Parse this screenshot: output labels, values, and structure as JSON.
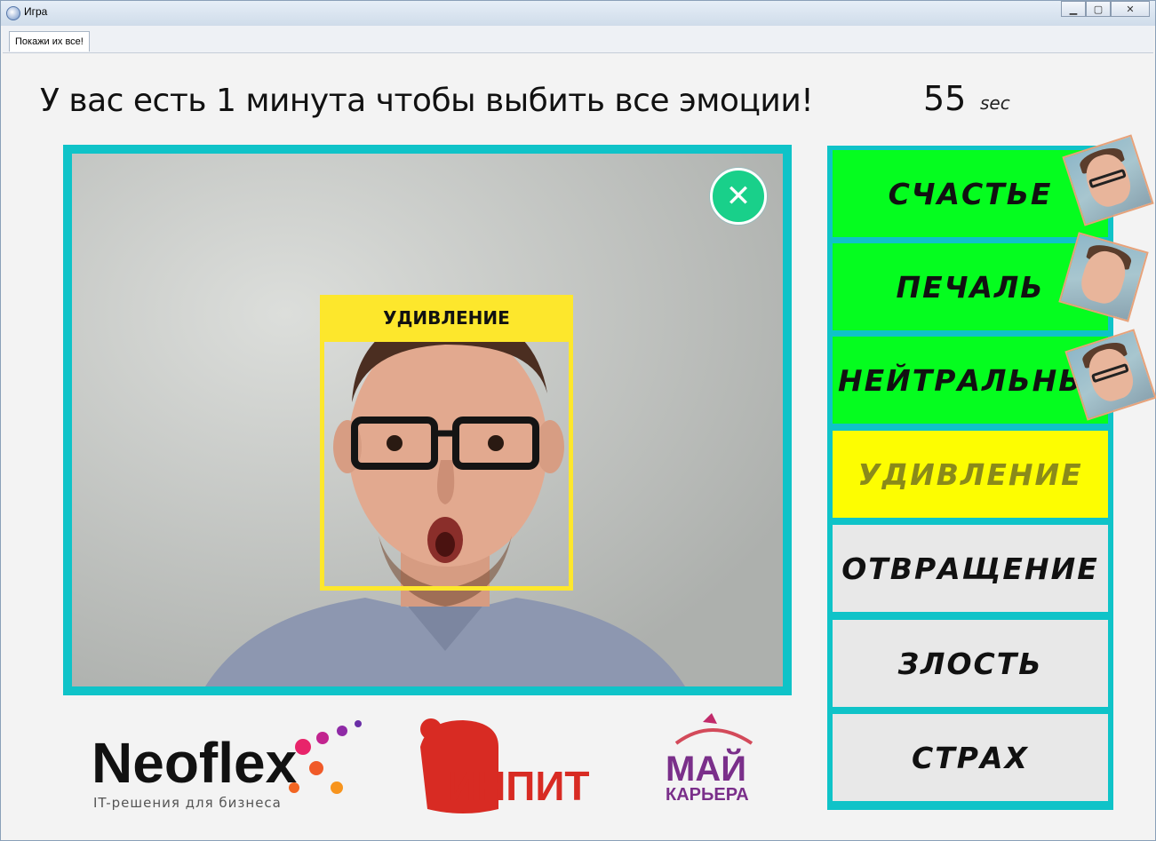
{
  "window": {
    "title": "Игра",
    "controls": {
      "minimize": "▁",
      "maximize": "▢",
      "close": "✕"
    }
  },
  "tabs": [
    {
      "label": "Покажи их все!"
    }
  ],
  "header": {
    "headline": "У вас есть 1 минута чтобы выбить все эмоции!",
    "timer_value": "55",
    "timer_unit": "sec"
  },
  "camera": {
    "detected_emotion": "УДИВЛЕНИЕ",
    "close_icon": "close-icon"
  },
  "emotions": [
    {
      "label": "СЧАСТЬЕ",
      "state": "done",
      "color": "#05fd1f"
    },
    {
      "label": "ПЕЧАЛЬ",
      "state": "done",
      "color": "#05fd1f"
    },
    {
      "label": "НЕЙТРАЛЬНЫ",
      "state": "done",
      "color": "#05fd1f"
    },
    {
      "label": "УДИВЛЕНИЕ",
      "state": "current",
      "color": "#fdfd01"
    },
    {
      "label": "ОТВРАЩЕНИЕ",
      "state": "pending",
      "color": "#e8e8e8"
    },
    {
      "label": "ЗЛОСТЬ",
      "state": "pending",
      "color": "#e8e8e8"
    },
    {
      "label": "СТРАХ",
      "state": "pending",
      "color": "#e8e8e8"
    }
  ],
  "logos": {
    "neoflex": {
      "name": "Neoflex",
      "tagline": "IT-решения для бизнеса"
    },
    "inpit": {
      "name": "ИНПИТ"
    },
    "my_career": {
      "line1": "МАЙ",
      "line2": "КАРЬЕРА"
    }
  },
  "colors": {
    "accent": "#0fc3c8",
    "detect": "#fde72c",
    "done": "#05fd1f",
    "current": "#fdfd01",
    "pending": "#e8e8e8",
    "close_button": "#19d08a"
  }
}
